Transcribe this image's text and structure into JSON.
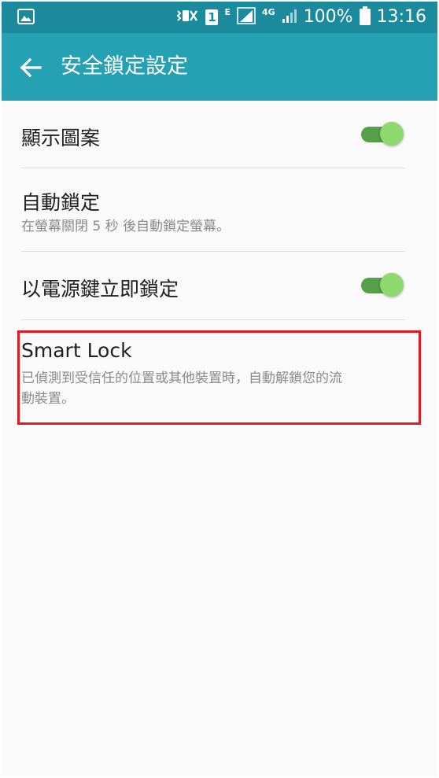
{
  "status_bar": {
    "sim_badge": "1",
    "network_e": "E",
    "network_4g": "4G",
    "battery": "100%",
    "time": "13:16"
  },
  "app_bar": {
    "title": "安全鎖定設定",
    "back_icon": "arrow-back-icon"
  },
  "settings": {
    "show_pattern": {
      "label": "顯示圖案",
      "toggle_on": true
    },
    "auto_lock": {
      "label": "自動鎖定",
      "description": "在螢幕關閉 5 秒 後自動鎖定螢幕。"
    },
    "power_key_lock": {
      "label": "以電源鍵立即鎖定",
      "toggle_on": true
    },
    "smart_lock": {
      "label": "Smart Lock",
      "description_line1": "已偵測到受信任的位置或其他裝置時，自動解鎖您的流",
      "description_line2": "動裝置。"
    }
  },
  "colors": {
    "status_bar": "#1b8a9c",
    "app_bar": "#26a0b3",
    "toggle_track": "#56a04a",
    "toggle_thumb": "#8ed96e",
    "highlight": "#e21a23"
  }
}
